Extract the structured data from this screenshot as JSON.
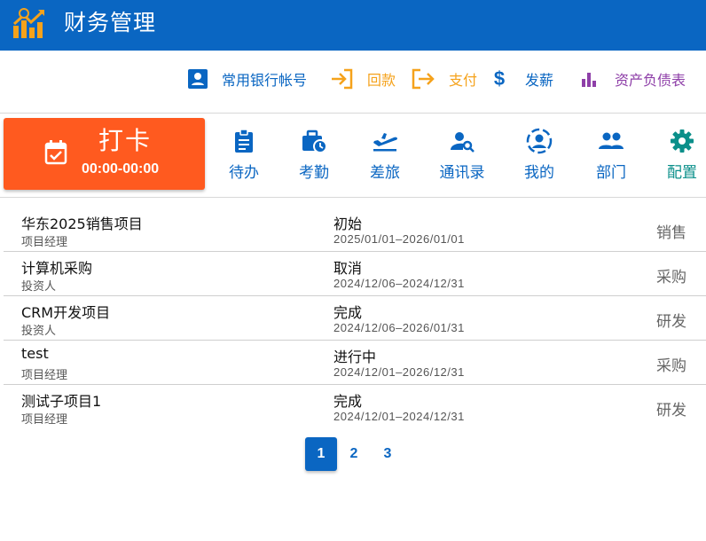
{
  "app": {
    "title": "财务管理"
  },
  "quick_actions": [
    {
      "label": "常用银行帐号",
      "icon": "contact-card-icon",
      "color": "#0a66c2"
    },
    {
      "label": "回款",
      "icon": "login-arrow-icon",
      "color": "#f5a21b"
    },
    {
      "label": "支付",
      "icon": "logout-arrow-icon",
      "color": "#f5a21b"
    },
    {
      "label": "发薪",
      "icon": "dollar-icon",
      "color": "#0a66c2"
    },
    {
      "label": "资产负债表",
      "icon": "bar-chart-icon",
      "color": "#8e3fa8"
    }
  ],
  "punch": {
    "label": "打卡",
    "time": "00:00-00:00",
    "icon": "calendar-check-icon",
    "color": "#ff5a1f"
  },
  "nav": [
    {
      "label": "待办",
      "icon": "clipboard-icon"
    },
    {
      "label": "考勤",
      "icon": "briefcase-clock-icon"
    },
    {
      "label": "差旅",
      "icon": "flight-takeoff-icon"
    },
    {
      "label": "通讯录",
      "icon": "person-search-icon"
    },
    {
      "label": "我的",
      "icon": "account-circle-icon"
    },
    {
      "label": "部门",
      "icon": "group-icon"
    },
    {
      "label": "配置",
      "icon": "gear-icon",
      "color": "#0a8f8a"
    }
  ],
  "projects": [
    {
      "name": "华东2025销售项目",
      "role": "项目经理",
      "status": "初始",
      "dates": "2025/01/01–2026/01/01",
      "category": "销售"
    },
    {
      "name": "计算机采购",
      "role": "投资人",
      "status": "取消",
      "dates": "2024/12/06–2024/12/31",
      "category": "采购"
    },
    {
      "name": "CRM开发项目",
      "role": "投资人",
      "status": "完成",
      "dates": "2024/12/06–2026/01/31",
      "category": "研发"
    },
    {
      "name": "test",
      "role": "项目经理",
      "status": "进行中",
      "dates": "2024/12/01–2026/12/31",
      "category": "采购"
    },
    {
      "name": "测试子项目1",
      "role": "项目经理",
      "status": "完成",
      "dates": "2024/12/01–2024/12/31",
      "category": "研发"
    }
  ],
  "pagination": {
    "pages": [
      "1",
      "2",
      "3"
    ],
    "current": "1"
  },
  "colors": {
    "primary": "#0a66c2",
    "accent": "#ff5a1f",
    "orange": "#f5a21b",
    "purple": "#8e3fa8",
    "teal": "#0a8f8a"
  }
}
